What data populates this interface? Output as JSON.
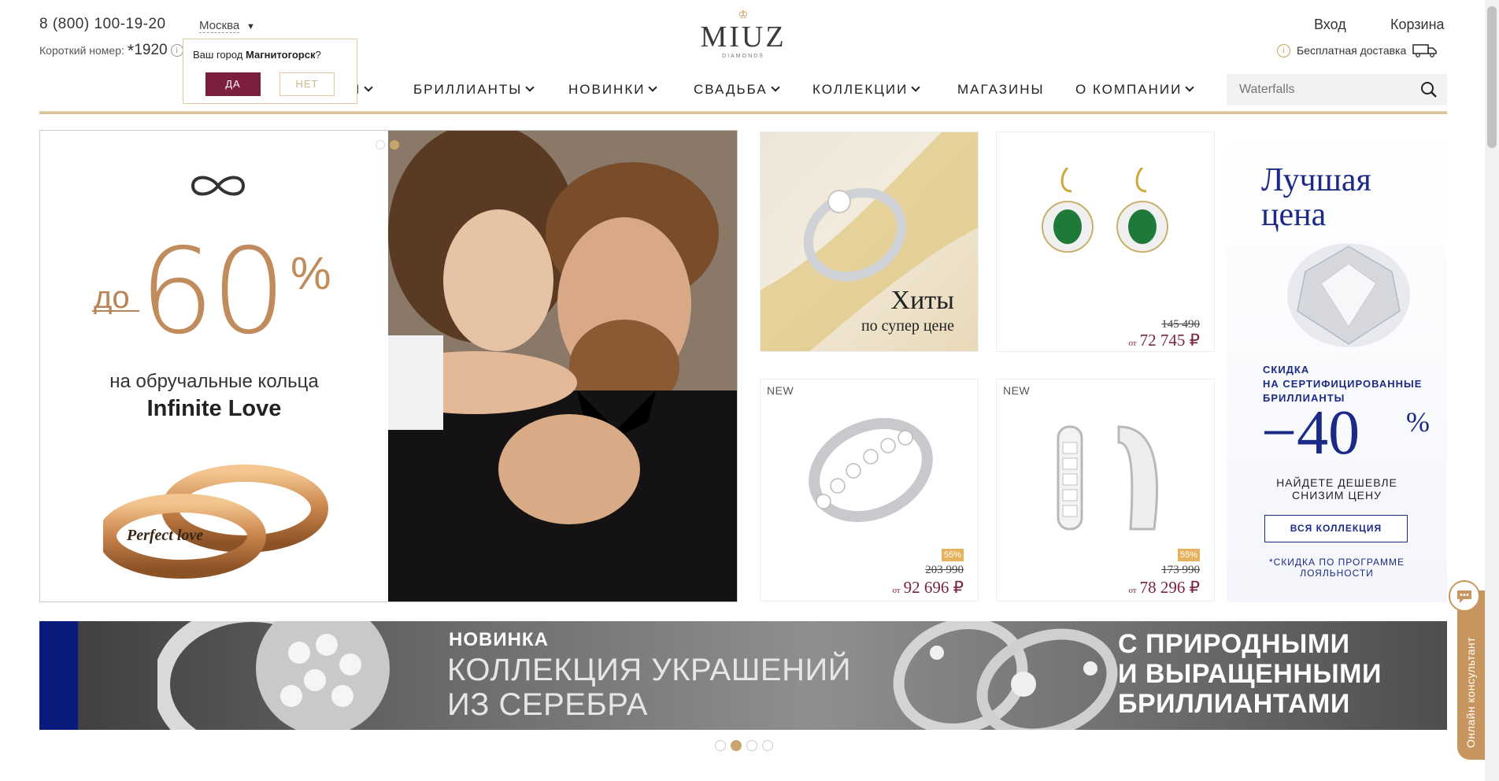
{
  "header": {
    "phone": "8 (800) 100-19-20",
    "short_label": "Короткий номер:",
    "short_star": "*",
    "short_number": "1920",
    "info": "i",
    "city": "Москва",
    "city_caret": "▼",
    "city_popup": {
      "question_prefix": "Ваш город ",
      "question_city": "Магнитогорск",
      "question_suffix": "?",
      "yes": "ДА",
      "no": "НЕТ"
    },
    "logo": {
      "name": "MIUZ",
      "sub": "DIAMONDS"
    },
    "login": "Вход",
    "cart": "Корзина",
    "delivery": "Бесплатная доставка",
    "search_placeholder": "Waterfalls"
  },
  "nav": [
    {
      "label": "Я",
      "chevron": true
    },
    {
      "label": "БРИЛЛИАНТЫ",
      "chevron": true
    },
    {
      "label": "НОВИНКИ",
      "chevron": true
    },
    {
      "label": "СВАДЬБА",
      "chevron": true
    },
    {
      "label": "КОЛЛЕКЦИИ",
      "chevron": true
    },
    {
      "label": "МАГАЗИНЫ",
      "chevron": false
    },
    {
      "label": "О КОМПАНИИ",
      "chevron": true
    }
  ],
  "hero": {
    "prefix": "до",
    "percent": "60",
    "percent_sign": "%",
    "line1": "на обручальные кольца",
    "line2": "Infinite Love",
    "ring_text": "Perfect love"
  },
  "cards": {
    "hits": {
      "title": "Хиты",
      "subtitle": "по супер цене"
    },
    "earrings_green": {
      "old": "145 490",
      "from": "от",
      "price": "72 745 ₽"
    },
    "ring_new": {
      "badge": "NEW",
      "discount": "55%",
      "old": "203 990",
      "from": "от",
      "price": "92 696 ₽"
    },
    "earrings_new": {
      "badge": "NEW",
      "discount": "55%",
      "old": "173 990",
      "from": "от",
      "price": "78 296 ₽"
    }
  },
  "promo": {
    "title_l1": "Лучшая",
    "title_l2": "цена",
    "sub_l1": "СКИДКА",
    "sub_l2": "НА СЕРТИФИЦИРОВАННЫЕ",
    "sub_l3": "БРИЛЛИАНТЫ",
    "big": "−40",
    "big_pct": "%",
    "mid_l1": "НАЙДЕТЕ ДЕШЕВЛЕ",
    "mid_l2": "СНИЗИМ ЦЕНУ",
    "button": "ВСЯ КОЛЛЕКЦИЯ",
    "note_l1": "*СКИДКА ПО ПРОГРАММЕ",
    "note_l2": "ЛОЯЛЬНОСТИ"
  },
  "banner": {
    "novelty": "НОВИНКА",
    "l1": "КОЛЛЕКЦИЯ УКРАШЕНИЙ",
    "l2": "ИЗ СЕРЕБРА",
    "r1": "С ПРИРОДНЫМИ",
    "r2": "И ВЫРАЩЕННЫМИ",
    "r3": "БРИЛЛИАНТАМИ"
  },
  "consultant": "Онлайн консультант",
  "colors": {
    "accent": "#7b1f3d",
    "gold": "#c9a56f",
    "navy": "#1b2a86"
  }
}
